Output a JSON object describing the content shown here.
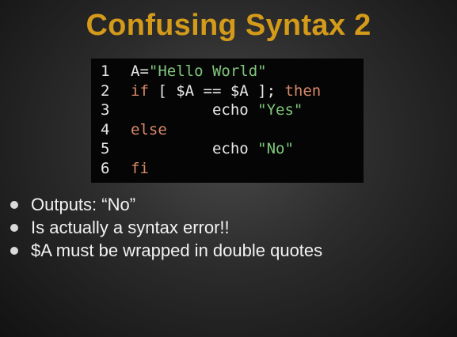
{
  "slide": {
    "title": "Confusing Syntax 2",
    "title_color": "#d49a1a"
  },
  "code": {
    "background": "#050505",
    "line_number_color": "#e8e8e8",
    "default_color": "#e8e8e8",
    "keyword_color": "#d98a6a",
    "string_color": "#7fc77b",
    "lines": [
      {
        "number": "1",
        "tokens": [
          {
            "text": "A=",
            "type": "plain"
          },
          {
            "text": "\"Hello World\"",
            "type": "string"
          }
        ]
      },
      {
        "number": "2",
        "tokens": [
          {
            "text": "if",
            "type": "keyword"
          },
          {
            "text": " [ $A == $A ]; ",
            "type": "plain"
          },
          {
            "text": "then",
            "type": "keyword"
          }
        ]
      },
      {
        "number": "3",
        "tokens": [
          {
            "text": "         echo ",
            "type": "plain"
          },
          {
            "text": "\"Yes\"",
            "type": "string"
          }
        ]
      },
      {
        "number": "4",
        "tokens": [
          {
            "text": "else",
            "type": "keyword"
          }
        ]
      },
      {
        "number": "5",
        "tokens": [
          {
            "text": "         echo ",
            "type": "plain"
          },
          {
            "text": "\"No\"",
            "type": "string"
          }
        ]
      },
      {
        "number": "6",
        "tokens": [
          {
            "text": "fi",
            "type": "keyword"
          }
        ]
      }
    ]
  },
  "bullets": {
    "text_color": "#f2f2f2",
    "bullet_color": "#d9d9d9",
    "items": [
      "Outputs: “No”",
      "Is actually a syntax error!!",
      "$A must be wrapped in double quotes"
    ]
  }
}
